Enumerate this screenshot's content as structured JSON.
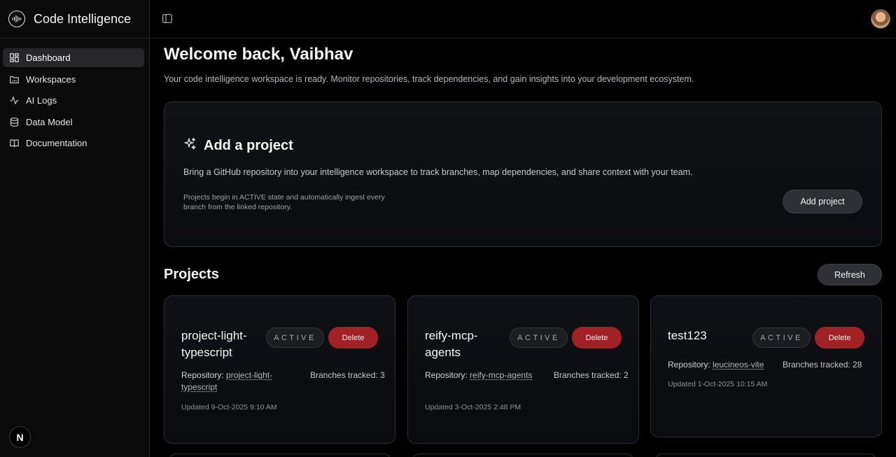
{
  "app": {
    "name": "Code Intelligence",
    "logo_icon": "waveform-globe-icon"
  },
  "sidebar": {
    "items": [
      {
        "label": "Dashboard",
        "icon": "dashboard-grid-icon",
        "active": true
      },
      {
        "label": "Workspaces",
        "icon": "folder-icon",
        "active": false
      },
      {
        "label": "AI Logs",
        "icon": "activity-icon",
        "active": false
      },
      {
        "label": "Data Model",
        "icon": "database-icon",
        "active": false
      },
      {
        "label": "Documentation",
        "icon": "book-open-icon",
        "active": false
      }
    ],
    "footer_badge": "N"
  },
  "topbar": {
    "toggle_icon": "sidebar-toggle-icon",
    "avatar": "user-avatar"
  },
  "main": {
    "welcome": "Welcome back, Vaibhav",
    "subtitle": "Your code intelligence workspace is ready. Monitor repositories, track dependencies, and gain insights into your development ecosystem."
  },
  "add_project": {
    "title": "Add a project",
    "icon": "sparkles-icon",
    "description": "Bring a GitHub repository into your intelligence workspace to track branches, map dependencies, and share context with your team.",
    "note": "Projects begin in ACTIVE state and automatically ingest every branch from the linked repository.",
    "button": "Add project"
  },
  "projects": {
    "title": "Projects",
    "refresh": "Refresh",
    "items": [
      {
        "name": "project-light-typescript",
        "status": "ACTIVE",
        "delete": "Delete",
        "repo_label": "Repository:",
        "repo": "project-light-typescript",
        "branches": "Branches tracked: 3",
        "updated": "Updated 9-Oct-2025 9:10 AM"
      },
      {
        "name": "reify-mcp-agents",
        "status": "ACTIVE",
        "delete": "Delete",
        "repo_label": "Repository:",
        "repo": "reify-mcp-agents",
        "branches": "Branches tracked: 2",
        "updated": "Updated 3-Oct-2025 2:48 PM"
      },
      {
        "name": "test123",
        "status": "ACTIVE",
        "delete": "Delete",
        "repo_label": "Repository:",
        "repo": "leucineos-vite",
        "branches": "Branches tracked: 28",
        "updated": "Updated 1-Oct-2025 10:15 AM"
      }
    ]
  }
}
